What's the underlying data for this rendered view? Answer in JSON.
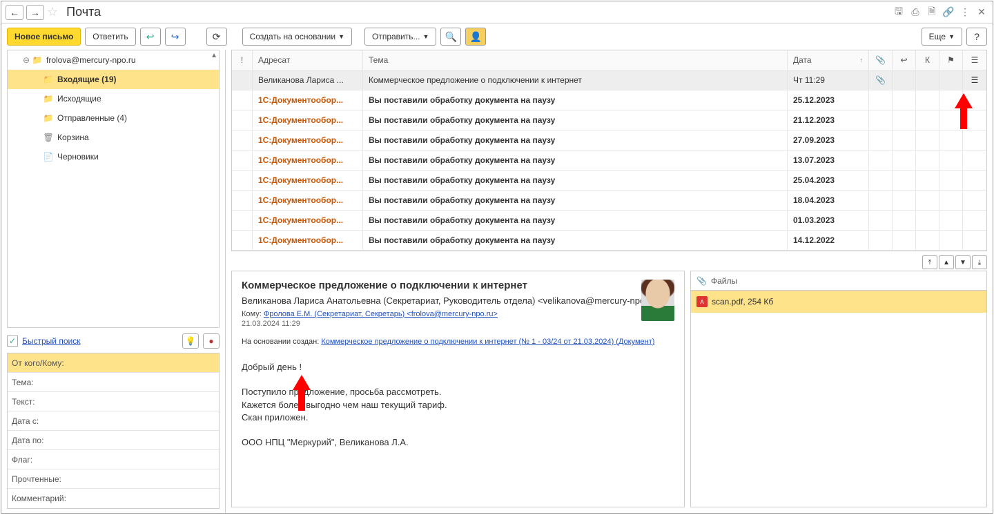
{
  "title": "Почта",
  "toolbar": {
    "new_letter": "Новое письмо",
    "reply": "Ответить",
    "create_based": "Создать на основании",
    "send": "Отправить...",
    "more": "Еще"
  },
  "folders": {
    "root": "frolova@mercury-npo.ru",
    "inbox": "Входящие (19)",
    "outbox": "Исходящие",
    "sent": "Отправленные (4)",
    "trash": "Корзина",
    "drafts": "Черновики"
  },
  "quick_search": {
    "label": "Быстрый поиск",
    "fields": {
      "from_to": "От кого/Кому:",
      "subject": "Тема:",
      "text": "Текст:",
      "date_from": "Дата с:",
      "date_to": "Дата по:",
      "flag": "Флаг:",
      "read": "Прочтенные:",
      "comment": "Комментарий:"
    }
  },
  "columns": {
    "from": "Адресат",
    "subject": "Тема",
    "date": "Дата",
    "k": "К"
  },
  "messages": [
    {
      "from": "Великанова Лариса ...",
      "subject": "Коммерческое предложение о подключении к интернет",
      "date": "Чт 11:29",
      "attach": true,
      "note": true,
      "selected": true,
      "orange": false,
      "bold": false
    },
    {
      "from": "1С:Документообор...",
      "subject": "Вы поставили обработку документа на паузу",
      "date": "25.12.2023",
      "orange": true,
      "bold": true
    },
    {
      "from": "1С:Документообор...",
      "subject": "Вы поставили обработку документа на паузу",
      "date": "21.12.2023",
      "orange": true,
      "bold": true
    },
    {
      "from": "1С:Документообор...",
      "subject": "Вы поставили обработку документа на паузу",
      "date": "27.09.2023",
      "orange": true,
      "bold": true
    },
    {
      "from": "1С:Документообор...",
      "subject": "Вы поставили обработку документа на паузу",
      "date": "13.07.2023",
      "orange": true,
      "bold": true
    },
    {
      "from": "1С:Документообор...",
      "subject": "Вы поставили обработку документа на паузу",
      "date": "25.04.2023",
      "orange": true,
      "bold": true
    },
    {
      "from": "1С:Документообор...",
      "subject": "Вы поставили обработку документа на паузу",
      "date": "18.04.2023",
      "orange": true,
      "bold": true
    },
    {
      "from": "1С:Документообор...",
      "subject": "Вы поставили обработку документа на паузу",
      "date": "01.03.2023",
      "orange": true,
      "bold": true
    },
    {
      "from": "1С:Документообор...",
      "subject": "Вы поставили обработку документа на паузу",
      "date": "14.12.2022",
      "orange": true,
      "bold": true
    }
  ],
  "preview": {
    "subject": "Коммерческое предложение о подключении к интернет",
    "sender_line": "Великанова Лариса Анатольевна (Секретариат, Руководитель отдела) <velikanova@mercury-npo.ru>",
    "to_label": "Кому:",
    "to_value": "Фролова Е.М. (Секретариат, Секретарь) <frolova@mercury-npo.ru>",
    "timestamp": "21.03.2024 11:29",
    "based_label": "На основании создан:",
    "based_link": "Коммерческое предложение о подключении к интернет (№ 1 - 03/24 от 21.03.2024) (Документ)",
    "body_greeting": "Добрый день !",
    "body_p1": "Поступило предложение, просьба рассмотреть.",
    "body_p2": "Кажется более выгодно чем наш текущий тариф.",
    "body_p3": "Скан приложен.",
    "body_sig": "ООО НПЦ \"Меркурий\", Великанова Л.А."
  },
  "files": {
    "header": "Файлы",
    "item": "scan.pdf, 254 Кб"
  }
}
